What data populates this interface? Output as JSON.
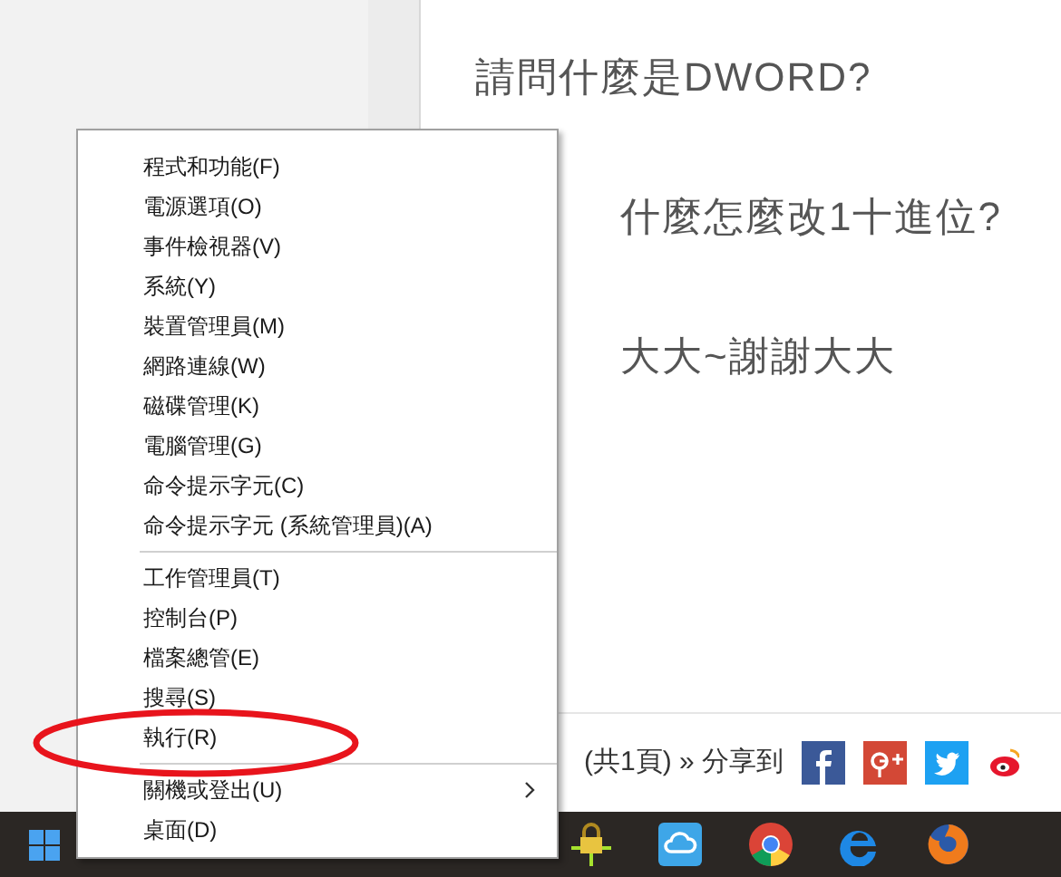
{
  "post": {
    "lines": [
      "請問什麼是DWORD?",
      "什麼怎麼改1十進位?",
      "大大~謝謝大大"
    ],
    "pager": "(共1頁) » 分享到",
    "share": [
      {
        "kind": "facebook"
      },
      {
        "kind": "googleplus"
      },
      {
        "kind": "twitter"
      },
      {
        "kind": "weibo"
      }
    ]
  },
  "menu": {
    "groups": [
      [
        {
          "label": "程式和功能(F)",
          "submenu": false,
          "circled": false
        },
        {
          "label": "電源選項(O)",
          "submenu": false,
          "circled": false
        },
        {
          "label": "事件檢視器(V)",
          "submenu": false,
          "circled": false
        },
        {
          "label": "系統(Y)",
          "submenu": false,
          "circled": false
        },
        {
          "label": "裝置管理員(M)",
          "submenu": false,
          "circled": false
        },
        {
          "label": "網路連線(W)",
          "submenu": false,
          "circled": false
        },
        {
          "label": "磁碟管理(K)",
          "submenu": false,
          "circled": false
        },
        {
          "label": "電腦管理(G)",
          "submenu": false,
          "circled": false
        },
        {
          "label": "命令提示字元(C)",
          "submenu": false,
          "circled": false
        },
        {
          "label": "命令提示字元 (系統管理員)(A)",
          "submenu": false,
          "circled": false
        }
      ],
      [
        {
          "label": "工作管理員(T)",
          "submenu": false,
          "circled": false
        },
        {
          "label": "控制台(P)",
          "submenu": false,
          "circled": false
        },
        {
          "label": "檔案總管(E)",
          "submenu": false,
          "circled": false
        },
        {
          "label": "搜尋(S)",
          "submenu": false,
          "circled": false
        },
        {
          "label": "執行(R)",
          "submenu": false,
          "circled": true
        }
      ],
      [
        {
          "label": "關機或登出(U)",
          "submenu": true,
          "circled": false
        },
        {
          "label": "桌面(D)",
          "submenu": false,
          "circled": false
        }
      ]
    ]
  }
}
